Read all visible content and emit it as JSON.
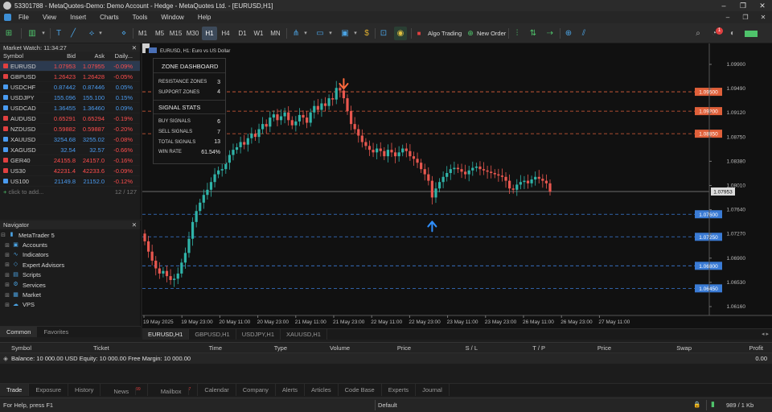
{
  "window": {
    "title": "53301788 - MetaQuotes-Demo: Demo Account - Hedge - MetaQuotes Ltd. - [EURUSD,H1]",
    "controls": [
      "–",
      "❐",
      "✕"
    ]
  },
  "menu": {
    "items": [
      "File",
      "View",
      "Insert",
      "Charts",
      "Tools",
      "Window",
      "Help"
    ],
    "right_controls": [
      "–",
      "❐",
      "✕"
    ]
  },
  "toolbar": {
    "timeframes": [
      "M1",
      "M5",
      "M15",
      "M30",
      "H1",
      "H4",
      "D1",
      "W1",
      "MN"
    ],
    "active_timeframe": "H1",
    "algo_trading": "Algo Trading",
    "new_order": "New Order",
    "notification_count": "1"
  },
  "market_watch": {
    "title": "Market Watch: 11:34:27",
    "columns": [
      "Symbol",
      "Bid",
      "Ask",
      "Daily..."
    ],
    "rows": [
      {
        "symbol": "EURUSD",
        "bid": "1.07953",
        "ask": "1.07955",
        "daily": "-0.09%",
        "dir": "dn",
        "selected": true
      },
      {
        "symbol": "GBPUSD",
        "bid": "1.26423",
        "ask": "1.26428",
        "daily": "-0.05%",
        "dir": "dn"
      },
      {
        "symbol": "USDCHF",
        "bid": "0.87442",
        "ask": "0.87446",
        "daily": "0.05%",
        "dir": "up"
      },
      {
        "symbol": "USDJPY",
        "bid": "155.096",
        "ask": "155.100",
        "daily": "0.15%",
        "dir": "up"
      },
      {
        "symbol": "USDCAD",
        "bid": "1.36455",
        "ask": "1.36460",
        "daily": "0.09%",
        "dir": "up"
      },
      {
        "symbol": "AUDUSD",
        "bid": "0.65291",
        "ask": "0.65294",
        "daily": "-0.19%",
        "dir": "dn"
      },
      {
        "symbol": "NZDUSD",
        "bid": "0.59882",
        "ask": "0.59887",
        "daily": "-0.20%",
        "dir": "dn"
      },
      {
        "symbol": "XAUUSD",
        "bid": "3254.68",
        "ask": "3255.02",
        "daily": "-0.08%",
        "dir": "up"
      },
      {
        "symbol": "XAGUSD",
        "bid": "32.54",
        "ask": "32.57",
        "daily": "-0.66%",
        "dir": "up"
      },
      {
        "symbol": "GER40",
        "bid": "24155.8",
        "ask": "24157.0",
        "daily": "-0.16%",
        "dir": "dn"
      },
      {
        "symbol": "US30",
        "bid": "42231.4",
        "ask": "42233.6",
        "daily": "-0.09%",
        "dir": "dn"
      },
      {
        "symbol": "US100",
        "bid": "21149.8",
        "ask": "21152.0",
        "daily": "-0.12%",
        "dir": "up"
      }
    ],
    "add_label": "click to add...",
    "count": "12 / 127"
  },
  "navigator": {
    "title": "Navigator",
    "items": [
      {
        "label": "MetaTrader 5",
        "icon": "metatrader-icon",
        "glyph": "▮",
        "level": 0
      },
      {
        "label": "Accounts",
        "icon": "accounts-icon",
        "glyph": "▣",
        "level": 1
      },
      {
        "label": "Indicators",
        "icon": "indicators-icon",
        "glyph": "∿",
        "level": 1
      },
      {
        "label": "Expert Advisors",
        "icon": "experts-icon",
        "glyph": "◇",
        "level": 1
      },
      {
        "label": "Scripts",
        "icon": "scripts-icon",
        "glyph": "▤",
        "level": 1
      },
      {
        "label": "Services",
        "icon": "services-icon",
        "glyph": "⚙",
        "level": 1
      },
      {
        "label": "Market",
        "icon": "market-icon",
        "glyph": "▦",
        "level": 1
      },
      {
        "label": "VPS",
        "icon": "vps-icon",
        "glyph": "☁",
        "level": 1
      }
    ],
    "tabs": [
      "Common",
      "Favorites"
    ]
  },
  "chart": {
    "header": "EURUSD, H1:  Euro vs US Dollar",
    "current_price": "1.07953",
    "price_axis": [
      "1.09900",
      "1.09490",
      "1.09120",
      "1.08750",
      "1.08380",
      "1.08010",
      "1.07640",
      "1.07270",
      "1.06900",
      "1.06530",
      "1.06160"
    ],
    "time_axis": [
      "19 May 2025",
      "19 May 23:00",
      "20 May 11:00",
      "20 May 23:00",
      "21 May 11:00",
      "21 May 23:00",
      "22 May 11:00",
      "22 May 23:00",
      "23 May 11:00",
      "23 May 23:00",
      "26 May 11:00",
      "26 May 23:00",
      "27 May 11:00"
    ],
    "resistance_levels": [
      "1.09500",
      "1.09200",
      "1.08850"
    ],
    "support_levels": [
      "1.07600",
      "1.07250",
      "1.06800",
      "1.06450"
    ],
    "colors": {
      "bull": "#2fb3a8",
      "bear": "#e8574f",
      "resistance": "#e0603a",
      "support": "#3a7bd5",
      "sell_arrow": "#ff6a3d",
      "buy_arrow": "#2f8fff"
    }
  },
  "chart_data": {
    "type": "candlestick",
    "title": "EURUSD, H1:  Euro vs US Dollar",
    "ylim": [
      1.0603,
      1.1025
    ],
    "close_series": [
      1.0718,
      1.0702,
      1.0688,
      1.0676,
      1.0668,
      1.0672,
      1.0664,
      1.0658,
      1.066,
      1.0668,
      1.0685,
      1.07,
      1.0722,
      1.0748,
      1.0765,
      1.0778,
      1.079,
      1.0798,
      1.081,
      1.0822,
      1.0828,
      1.083,
      1.084,
      1.0852,
      1.086,
      1.0864,
      1.0872,
      1.0868,
      1.0878,
      1.0885,
      1.088,
      1.0892,
      1.09,
      1.0896,
      1.091,
      1.0915,
      1.0906,
      1.0912,
      1.0918,
      1.0906,
      1.0898,
      1.0904,
      1.0914,
      1.091,
      1.0902,
      1.0918,
      1.0928,
      1.0922,
      1.0932,
      1.0928,
      1.094,
      1.0938,
      1.0956,
      1.0952,
      1.094,
      1.092,
      1.09,
      1.0892,
      1.0882,
      1.0872,
      1.0866,
      1.086,
      1.0856,
      1.0862,
      1.0858,
      1.085,
      1.086,
      1.0856,
      1.085,
      1.0856,
      1.0862,
      1.0858,
      1.085,
      1.0846,
      1.084,
      1.083,
      1.0822,
      1.0812,
      1.0786,
      1.08,
      1.081,
      1.0818,
      1.0824,
      1.083,
      1.0832,
      1.083,
      1.0826,
      1.0822,
      1.0828,
      1.0832,
      1.0834,
      1.083,
      1.0828,
      1.0826,
      1.0824,
      1.0822,
      1.082,
      1.0818,
      1.0812,
      1.08,
      1.0798,
      1.0806,
      1.081,
      1.0812,
      1.0808,
      1.0814,
      1.0818,
      1.0815,
      1.0812,
      1.0808,
      1.0795
    ],
    "resistance_levels": [
      1.095,
      1.092,
      1.0885
    ],
    "support_levels": [
      1.076,
      1.0725,
      1.068,
      1.0645
    ],
    "current_price": 1.07953,
    "sell_signal_index": 54,
    "buy_signal_index": 78
  },
  "dashboard": {
    "title": "ZONE DASHBOARD",
    "zone_rows": [
      {
        "label": "RESISTANCE ZONES",
        "value": "3"
      },
      {
        "label": "SUPPORT ZONES",
        "value": "4"
      }
    ],
    "signal_title": "SIGNAL STATS",
    "signal_rows": [
      {
        "label": "BUY SIGNALS",
        "value": "6"
      },
      {
        "label": "SELL SIGNALS",
        "value": "7"
      },
      {
        "label": "TOTAL SIGNALS",
        "value": "13"
      },
      {
        "label": "WIN RATE",
        "value": "61.54%"
      }
    ]
  },
  "chart_tabs": [
    "EURUSD,H1",
    "GBPUSD,H1",
    "USDJPY,H1",
    "XAUUSD,H1"
  ],
  "toolbox": {
    "columns": [
      "Symbol",
      "Ticket",
      "Time",
      "Type",
      "Volume",
      "Price",
      "S / L",
      "T / P",
      "Price",
      "Swap",
      "Profit"
    ],
    "balance_text": "Balance: 10 000.00 USD   Equity: 10 000.00   Free Margin: 10 000.00",
    "profit": "0.00",
    "tabs": [
      "Trade",
      "Exposure",
      "History",
      "News",
      "Mailbox",
      "Calendar",
      "Company",
      "Alerts",
      "Articles",
      "Code Base",
      "Experts",
      "Journal"
    ],
    "news_badge": "99",
    "mailbox_badge": "7"
  },
  "status": {
    "help": "For Help, press F1",
    "profile": "Default",
    "traffic": "989 / 1 Kb"
  }
}
